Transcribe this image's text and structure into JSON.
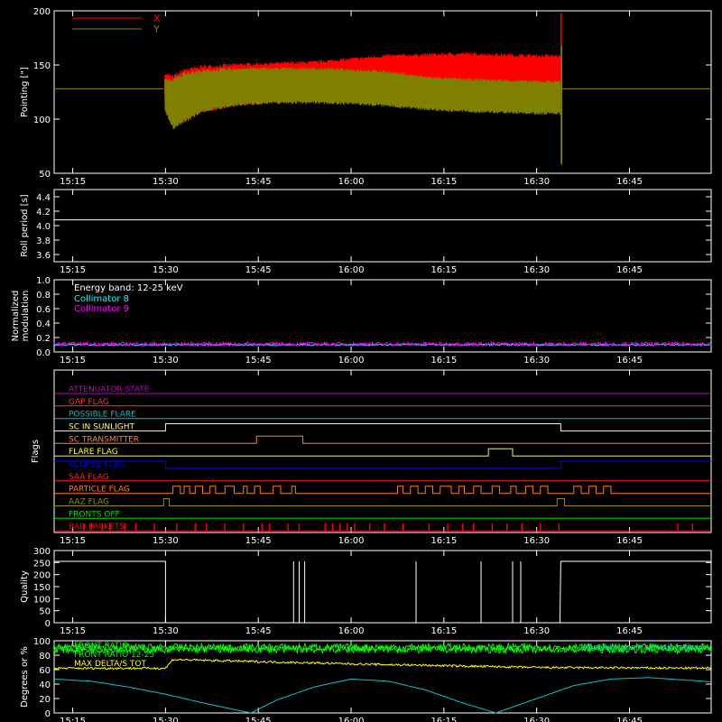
{
  "time_axis": {
    "tick_labels": [
      "15:15",
      "15:30",
      "15:45",
      "16:00",
      "16:15",
      "16:30",
      "16:45"
    ],
    "tick_values_hours": [
      15.25,
      15.5,
      15.75,
      16.0,
      16.25,
      16.5,
      16.75
    ],
    "range_hours": [
      15.2,
      16.97
    ]
  },
  "colors": {
    "x_pointing": "#ff0000",
    "y_pointing": "#808000",
    "collimator_8": "#00ffff",
    "collimator_9": "#ff00ff",
    "attenuator_state": "#c000c0",
    "gap_flag": "#ff3030",
    "possible_flare": "#00c0c0",
    "sc_in_sunlight": "#ffff60",
    "sc_transmitter": "#ff8040",
    "flare_flag": "#ffff00",
    "eclipse_flag": "#0000ff",
    "saa_flag": "#ff2020",
    "particle_flag": "#ff8000",
    "aaz_flag": "#909000",
    "fronts_off": "#00e000",
    "bad_packets": "#ff0000",
    "front_ratio": "#00ff00",
    "front_ratio_1225": "#00ff00",
    "max_delta_tot": "#ffff00",
    "abs_geomagnetic_latitude": "#00c8c8"
  },
  "chart_data": [
    {
      "type": "line",
      "panel": "pointing",
      "ylabel": "Pointing [\"]",
      "ylim": [
        50,
        200
      ],
      "yticks": [
        50,
        100,
        150,
        200
      ],
      "legend_placement": "top-left",
      "series": [
        {
          "name": "X",
          "segments": [
            {
              "x_hours": [
                15.2,
                15.495
              ],
              "y": [
                128,
                128
              ]
            },
            {
              "x_hours": [
                15.498,
                15.52,
                15.55,
                15.6,
                15.7,
                15.8,
                15.9,
                16.0,
                16.1,
                16.2,
                16.3,
                16.4,
                16.5,
                16.565
              ],
              "center": [
                128,
                116,
                122,
                128,
                132,
                134,
                135,
                138,
                141,
                142,
                142,
                141,
                140,
                140
              ],
              "amplitude": [
                15,
                25,
                25,
                22,
                20,
                19,
                19,
                19,
                19,
                19,
                20,
                20,
                20,
                20
              ]
            },
            {
              "x_hours": [
                16.568,
                16.97
              ],
              "y": [
                128,
                128
              ]
            }
          ]
        },
        {
          "name": "Y",
          "segments": [
            {
              "x_hours": [
                15.2,
                15.495
              ],
              "y": [
                128,
                128
              ]
            },
            {
              "x_hours": [
                15.498,
                15.52,
                15.55,
                15.6,
                15.7,
                15.8,
                15.9,
                16.0,
                16.1,
                16.2,
                16.3,
                16.4,
                16.5,
                16.565
              ],
              "center": [
                122,
                114,
                120,
                126,
                130,
                131,
                131,
                130,
                128,
                124,
                122,
                121,
                120,
                120
              ],
              "amplitude": [
                15,
                24,
                24,
                20,
                18,
                17,
                17,
                17,
                17,
                16,
                16,
                16,
                16,
                16
              ]
            },
            {
              "x_hours": [
                16.568,
                16.97
              ],
              "y": [
                128,
                128
              ]
            }
          ]
        }
      ]
    },
    {
      "type": "line",
      "panel": "roll_period",
      "ylabel": "Roll period [s]",
      "ylim": [
        3.5,
        4.5
      ],
      "yticks": [
        3.6,
        3.8,
        4.0,
        4.2,
        4.4
      ],
      "series": [
        {
          "x_hours": [
            15.2,
            16.97
          ],
          "y": [
            4.08,
            4.08
          ]
        }
      ]
    },
    {
      "type": "line",
      "panel": "modulation",
      "ylabel": "Normalized modulation",
      "ylim": [
        0,
        1.0
      ],
      "yticks": [
        0.0,
        0.2,
        0.4,
        0.6,
        0.8,
        1.0
      ],
      "annotations": [
        "Energy band: 12-25 keV"
      ],
      "series": [
        {
          "name": "Collimator 8",
          "mean": 0.1
        },
        {
          "name": "Collimator 9",
          "mean": 0.11,
          "noise": 0.025
        }
      ]
    },
    {
      "type": "line",
      "panel": "flags",
      "ylabel": "Flags",
      "flags": [
        {
          "name": "ATTENUATOR STATE",
          "color_key": "attenuator_state",
          "high": []
        },
        {
          "name": "GAP FLAG",
          "color_key": "gap_flag",
          "high": []
        },
        {
          "name": "POSSIBLE FLARE",
          "color_key": "possible_flare",
          "high": []
        },
        {
          "name": "SC IN SUNLIGHT",
          "color_key": "sc_in_sunlight",
          "high": [
            [
              15.5,
              16.565
            ]
          ]
        },
        {
          "name": "SC TRANSMITTER",
          "color_key": "sc_transmitter",
          "high": [
            [
              15.745,
              15.87
            ]
          ]
        },
        {
          "name": "FLARE FLAG",
          "color_key": "flare_flag",
          "high": [
            [
              16.37,
              16.435
            ]
          ]
        },
        {
          "name": "ECLIPSE FLAG",
          "color_key": "eclipse_flag",
          "high": [
            [
              15.2,
              15.5
            ],
            [
              16.565,
              16.97
            ]
          ]
        },
        {
          "name": "SAA FLAG",
          "color_key": "saa_flag",
          "high": []
        },
        {
          "name": "PARTICLE FLAG",
          "color_key": "particle_flag",
          "high": [
            [
              15.52,
              15.54
            ],
            [
              15.55,
              15.565
            ],
            [
              15.58,
              15.6
            ],
            [
              15.62,
              15.635
            ],
            [
              15.66,
              15.685
            ],
            [
              15.71,
              15.72
            ],
            [
              15.74,
              15.755
            ],
            [
              15.79,
              15.81
            ],
            [
              15.84,
              15.85
            ],
            [
              16.125,
              16.14
            ],
            [
              16.16,
              16.18
            ],
            [
              16.2,
              16.22
            ],
            [
              16.24,
              16.27
            ],
            [
              16.29,
              16.305
            ],
            [
              16.33,
              16.35
            ],
            [
              16.38,
              16.4
            ],
            [
              16.43,
              16.445
            ],
            [
              16.47,
              16.49
            ],
            [
              16.51,
              16.53
            ],
            [
              16.6,
              16.62
            ],
            [
              16.64,
              16.66
            ],
            [
              16.68,
              16.7
            ]
          ]
        },
        {
          "name": "AAZ FLAG",
          "color_key": "aaz_flag",
          "high": [
            [
              15.495,
              15.51
            ],
            [
              16.555,
              16.575
            ]
          ]
        },
        {
          "name": "FRONTS OFF",
          "color_key": "fronts_off",
          "high": []
        },
        {
          "name": "BAD PACKETS",
          "color_key": "bad_packets",
          "spikes_hours": [
            15.28,
            15.3,
            15.33,
            15.35,
            15.39,
            15.42,
            15.47,
            15.53,
            15.58,
            15.61,
            15.66,
            15.71,
            15.76,
            15.78,
            15.83,
            15.86,
            15.93,
            15.95,
            15.97,
            15.99,
            16.01,
            16.05,
            16.09,
            16.14,
            16.21,
            16.26,
            16.3,
            16.33,
            16.38,
            16.42,
            16.46,
            16.51,
            16.56,
            16.88,
            16.92
          ]
        }
      ]
    },
    {
      "type": "line",
      "panel": "quality",
      "ylabel": "Quality",
      "ylim": [
        0,
        300
      ],
      "yticks": [
        0,
        50,
        100,
        150,
        200,
        250,
        300
      ],
      "series": [
        {
          "base": 255,
          "segments": [
            [
              15.2,
              15.5
            ],
            [
              16.565,
              16.97
            ]
          ],
          "spikes_hours": [
            15.845,
            15.86,
            15.875,
            16.175,
            16.35,
            16.435,
            16.457
          ]
        }
      ]
    },
    {
      "type": "line",
      "panel": "misc",
      "ylabel": "Degrees or %",
      "ylim": [
        0,
        100
      ],
      "yticks": [
        0,
        20,
        40,
        60,
        80,
        100
      ],
      "series": [
        {
          "name": "FRONT RATIO",
          "color_key": "front_ratio",
          "mean": 91,
          "noise": 5
        },
        {
          "name": "FRONT RATIO 12-25",
          "color_key": "front_ratio_1225",
          "mean": 88,
          "noise": 5
        },
        {
          "name": "MAX DELTA/S TOT",
          "color_key": "max_delta_tot",
          "x_hours": [
            15.2,
            15.5,
            15.52,
            16.0,
            16.5,
            16.97
          ],
          "y": [
            62,
            62,
            74,
            68,
            63,
            62
          ]
        },
        {
          "name": "Absolute geomagnetic latitude",
          "color_key": "abs_geomagnetic_latitude",
          "x_hours": [
            15.2,
            15.3,
            15.4,
            15.5,
            15.6,
            15.73,
            15.8,
            15.9,
            16.0,
            16.1,
            16.2,
            16.3,
            16.39,
            16.5,
            16.6,
            16.7,
            16.8,
            16.92,
            16.97
          ],
          "y": [
            47,
            44,
            36,
            26,
            14,
            0,
            18,
            36,
            47,
            44,
            32,
            14,
            0,
            20,
            38,
            47,
            49,
            45,
            43
          ]
        }
      ]
    }
  ]
}
